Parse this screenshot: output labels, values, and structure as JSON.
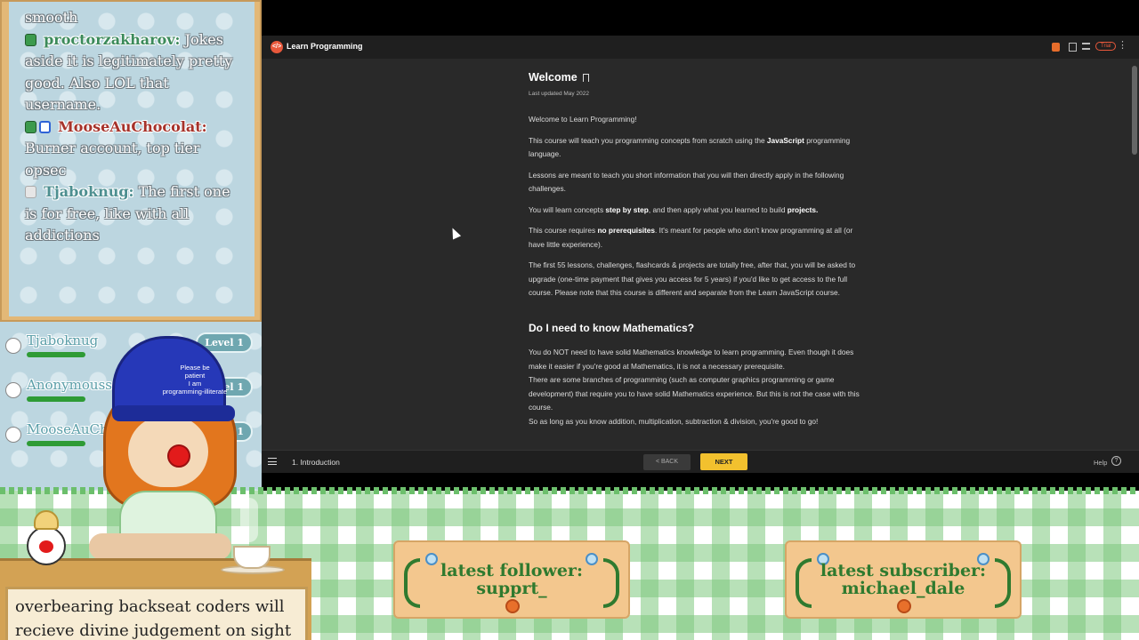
{
  "chat": {
    "messages": [
      {
        "user": "",
        "badge": "",
        "text": "smooth"
      },
      {
        "user": "proctorzakharov:",
        "badge": "green",
        "text": "Jokes aside it is legitimately pretty good. Also LOL that username."
      },
      {
        "user": "MooseAuChocolat:",
        "badge": "green-blue",
        "text": "Burner account, top tier opsec"
      },
      {
        "user": "Tjaboknug:",
        "badge": "grey",
        "text": "The first one is for free, like with all addictions"
      }
    ]
  },
  "viewers": [
    {
      "name": "Tjaboknug",
      "level": "Level 1",
      "progress": 0.3
    },
    {
      "name": "Anonymouss",
      "level": "Level 1",
      "progress": 0.3
    },
    {
      "name": "MooseAuCho",
      "level": "Level 1",
      "progress": 0.3
    }
  ],
  "app": {
    "title": "Learn Programming",
    "trial_label": "Trial",
    "lesson": {
      "title": "Welcome",
      "last_updated": "Last updated May 2022",
      "intro": "Welcome to Learn Programming!",
      "p1_a": "This course will teach you programming concepts from scratch using the ",
      "p1_b": "JavaScript",
      "p1_c": " programming language.",
      "p2": "Lessons are meant to teach you short information that you will then directly apply in the following challenges.",
      "p3_a": "You will learn concepts ",
      "p3_b": "step by step",
      "p3_c": ", and then apply what you learned to build ",
      "p3_d": "projects.",
      "p4_a": "This course requires ",
      "p4_b": "no prerequisites",
      "p4_c": ". It's meant for people who don't know programming at all (or have little experience).",
      "p5": "The first 55 lessons, challenges, flashcards & projects are totally free, after that, you will be asked to upgrade (one-time payment that gives you access for 5 years) if you'd like to get access to the full course. Please note that this course is different and separate from the Learn JavaScript course.",
      "math_heading": "Do I need to know Mathematics?",
      "m1": "You do NOT need to have solid Mathematics knowledge to learn programming. Even though it does make it easier if you're good at Mathematics, it is not a necessary prerequisite.",
      "m2": "There are some branches of programming (such as computer graphics programming or game development) that require you to have solid Mathematics experience. But this is not the case with this course.",
      "m3": "So as long as you know addition, multiplication, subtraction & division, you're good to go!"
    },
    "bottom": {
      "chapter": "1. Introduction",
      "back_label": "< BACK",
      "next_label": "NEXT",
      "help_label": "Help",
      "help_icon": "?"
    }
  },
  "overlay": {
    "hat_text": "Please be\npatient\nI am\nprogramming-illiterate",
    "follower_label": "latest follower:",
    "follower_name": "supprt_",
    "subscriber_label": "latest subscriber:",
    "subscriber_name": "michael_dale",
    "banner_line1": "overbearing backseat coders will",
    "banner_line2": "recieve divine judgement on sight"
  }
}
